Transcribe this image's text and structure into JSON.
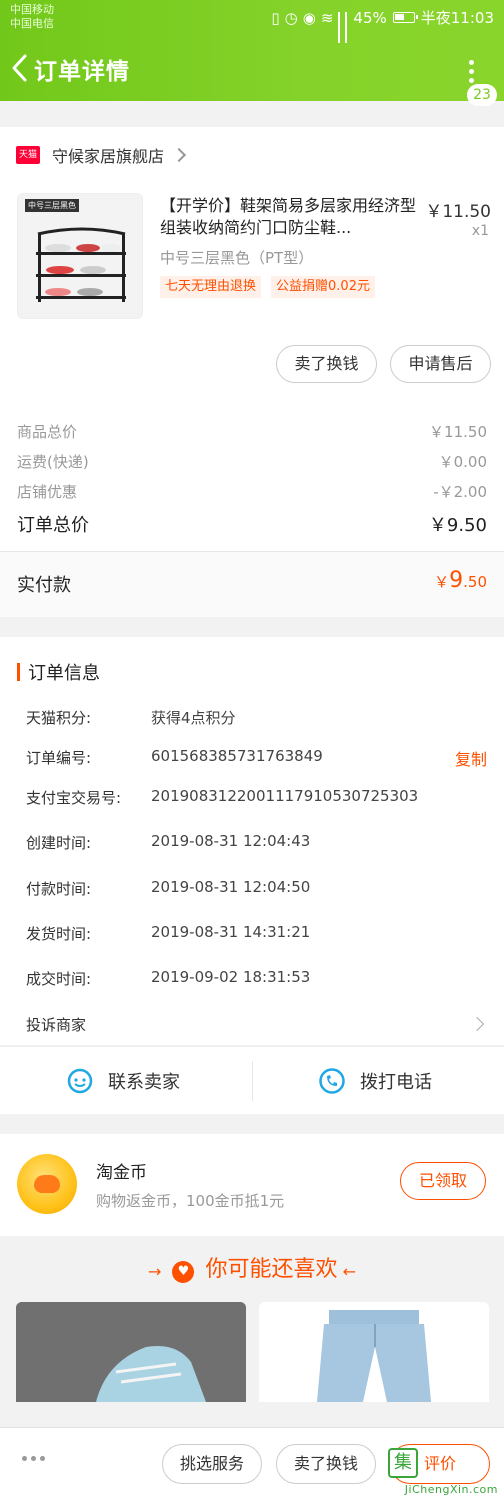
{
  "status_bar": {
    "carrier1": "中国移动",
    "carrier2": "中国电信",
    "battery": "45%",
    "time": "半夜11:03"
  },
  "header": {
    "title": "订单详情",
    "badge": "23"
  },
  "shop": {
    "logo_text": "天猫",
    "name": "守候家居旗舰店"
  },
  "product": {
    "thumb_label": "中号三层黑色",
    "title": "【开学价】鞋架简易多层家用经济型组装收纳简约门口防尘鞋...",
    "price": "￥11.50",
    "qty": "x1",
    "sku": "中号三层黑色（PT型）",
    "tags": [
      "七天无理由退换",
      "公益捐赠0.02元"
    ],
    "actions": [
      "卖了换钱",
      "申请售后"
    ]
  },
  "fees": [
    {
      "label": "商品总价",
      "value": "￥11.50"
    },
    {
      "label": "运费(快递)",
      "value": "￥0.00"
    },
    {
      "label": "店铺优惠",
      "value": "-￥2.00"
    }
  ],
  "order_total": {
    "label": "订单总价",
    "value": "￥9.50"
  },
  "paid": {
    "label": "实付款",
    "currency": "￥",
    "int": "9",
    "dec": ".50"
  },
  "order_info": {
    "title": "订单信息",
    "rows": [
      {
        "label": "天猫积分:",
        "value": "获得4点积分"
      },
      {
        "label": "订单编号:",
        "value": "601568385731763849",
        "action": "复制"
      },
      {
        "label": "支付宝交易号:",
        "value": "2019083122001117910530725303"
      },
      {
        "label": "创建时间:",
        "value": "2019-08-31 12:04:43"
      },
      {
        "label": "付款时间:",
        "value": "2019-08-31 12:04:50"
      },
      {
        "label": "发货时间:",
        "value": "2019-08-31 14:31:21"
      },
      {
        "label": "成交时间:",
        "value": "2019-09-02 18:31:53"
      }
    ],
    "complaint": "投诉商家"
  },
  "contact": {
    "seller": "联系卖家",
    "phone": "拨打电话"
  },
  "coin": {
    "title": "淘金币",
    "subtitle": "购物返金币，100金币抵1元",
    "button": "已领取"
  },
  "recommend": {
    "title": "你可能还喜欢"
  },
  "bottom_bar": {
    "buttons": [
      "挑选服务",
      "卖了换钱",
      "评价"
    ],
    "watermark_logo": "集",
    "watermark": "JiChengXin.com"
  },
  "colors": {
    "header_green": "#7acb1f",
    "accent_orange": "#ff5000",
    "tmall_red": "#ff0036"
  }
}
